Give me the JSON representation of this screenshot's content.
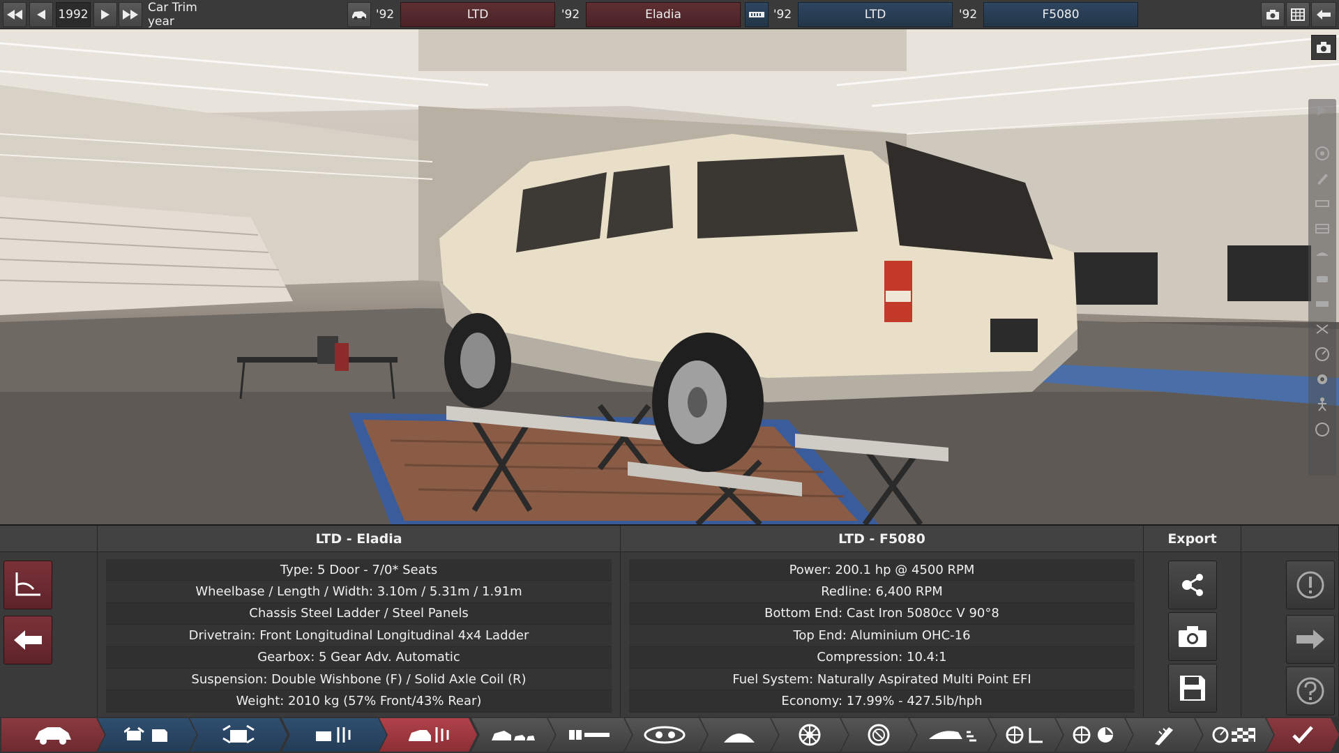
{
  "topbar": {
    "year": "1992",
    "year_label": "Car Trim year",
    "left_group": {
      "model_year": "'92",
      "model_name": "LTD",
      "trim_year": "'92",
      "trim_name": "Eladia"
    },
    "right_group": {
      "family_year": "'92",
      "family_name": "LTD",
      "variant_year": "'92",
      "variant_name": "F5080"
    }
  },
  "panel": {
    "car_header": "LTD - Eladia",
    "engine_header": "LTD - F5080",
    "export_header": "Export",
    "car_specs": [
      "Type: 5 Door - 7/0* Seats",
      "Wheelbase / Length / Width: 3.10m / 5.31m / 1.91m",
      "Chassis Steel Ladder / Steel Panels",
      "Drivetrain: Front Longitudinal Longitudinal 4x4 Ladder",
      "Gearbox: 5 Gear Adv. Automatic",
      "Suspension: Double Wishbone (F) / Solid Axle Coil (R)",
      "Weight: 2010 kg (57% Front/43% Rear)"
    ],
    "engine_specs": [
      "Power: 200.1 hp @ 4500 RPM",
      "Redline:  6,400 RPM",
      "Bottom End: Cast Iron 5080cc V 90°8",
      "Top End: Aluminium OHC-16",
      "Compression: 10.4:1",
      "Fuel System: Naturally Aspirated Multi Point EFI",
      "Economy: 17.99% - 427.5lb/hph"
    ]
  },
  "icons": {
    "top_left": [
      "first-icon",
      "prev-icon",
      "next-icon",
      "last-icon"
    ],
    "top_right": [
      "camera-icon",
      "spreadsheet-icon",
      "back-icon"
    ],
    "bottom_tabs": [
      "car-body-icon",
      "engine-family-icon",
      "engine-icon",
      "engine-tune-icon",
      "trim-icon",
      "body-icon",
      "chassis-icon",
      "drivetrain-icon",
      "suspension-icon",
      "wheels-icon",
      "brakes-icon",
      "aero-icon",
      "interior-icon",
      "safety-icon",
      "fixtures-icon",
      "testing-icon",
      "done-icon"
    ]
  },
  "colors": {
    "car_red": "#7a3238",
    "engine_blue": "#2f4661",
    "active_tab": "#b0424a"
  }
}
